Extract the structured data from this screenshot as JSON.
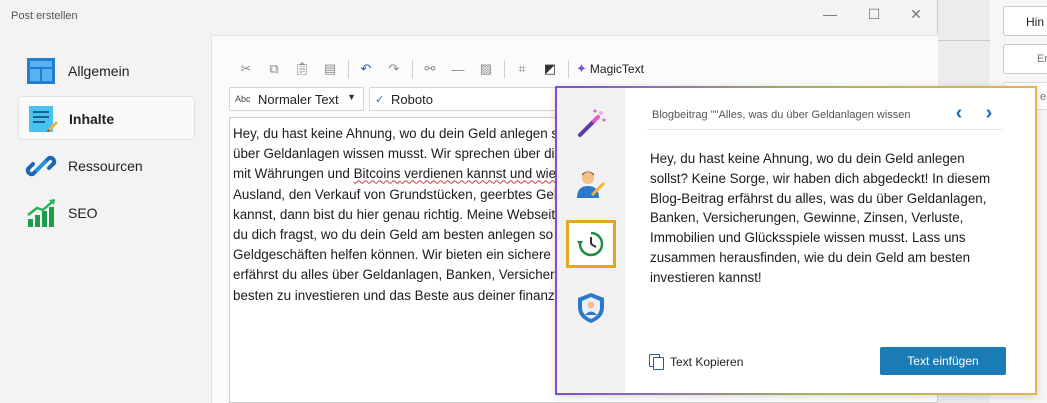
{
  "window": {
    "title": "Post erstellen",
    "minimize_glyph": "—",
    "maximize_glyph": "☐",
    "close_glyph": "✕"
  },
  "background_window": {
    "buttons": [
      "Hin",
      "Er",
      "ea"
    ]
  },
  "sidebar": {
    "items": [
      {
        "label": "Allgemein",
        "icon": "layout-icon",
        "active": false
      },
      {
        "label": "Inhalte",
        "icon": "document-edit-icon",
        "active": true
      },
      {
        "label": "Ressourcen",
        "icon": "link-icon",
        "active": false
      },
      {
        "label": "SEO",
        "icon": "growth-chart-icon",
        "active": false
      }
    ]
  },
  "toolbar": {
    "icons": [
      "cut-icon",
      "copy-icon",
      "paste-icon",
      "paste-text-icon",
      "undo-icon",
      "redo-icon",
      "insert-link-icon",
      "horizontal-rule-icon",
      "image-icon",
      "source-code-icon",
      "contrast-icon"
    ],
    "magic_label": "MagicText"
  },
  "format_select": {
    "prefix": "Abc",
    "value": "Normaler Text"
  },
  "font_select": {
    "check": "✓",
    "value": "Roboto"
  },
  "editor": {
    "lines": [
      "Hey, du hast keine Ahnung, wo du dein Geld anlegen s",
      "über Geldanlagen wissen musst. Wir sprechen über di",
      "mit Währungen und ",
      "Bitcoins",
      " verdienen kannst und wie",
      "Ausland, den Verkauf von Grundstücken, geerbtes Gel",
      "kannst, dann bist du hier genau richtig. Meine Webseit",
      "du dich fragst, wo du dein Geld am besten anlegen so",
      "Geldgeschäften helfen können. Wir bieten ein sichere",
      "erfährst du alles über Geldanlagen, Banken, Versicher",
      "besten zu investieren und das Beste aus deiner finanz"
    ]
  },
  "magic_popup": {
    "header": "Blogbeitrag \"\"Alles, was du über Geldanlagen wissen",
    "prev": "‹",
    "next": "›",
    "side_icons": [
      "magic-wand-icon",
      "writer-icon",
      "history-icon",
      "shield-user-icon"
    ],
    "selected_side_icon": "history-icon",
    "text_lines": [
      "Hey, du hast keine Ahnung, wo du dein Geld anlegen",
      "sollst? Keine Sorge, wir haben dich abgedeckt! In diesem",
      "Blog-Beitrag erfährst du alles, was du über Geldanlagen,",
      "Banken, Versicherungen, Gewinne, Zinsen, Verluste,",
      "Immobilien und Glücksspiele wissen musst. Lass uns",
      "zusammen herausfinden, wie du dein Geld am besten",
      "investieren kannst!"
    ],
    "copy_label": "Text Kopieren",
    "insert_label": "Text einfügen"
  },
  "colors": {
    "accent_blue": "#1a7bb5",
    "selected_border": "#e3a822",
    "spellcheck": "#d13c3c"
  }
}
